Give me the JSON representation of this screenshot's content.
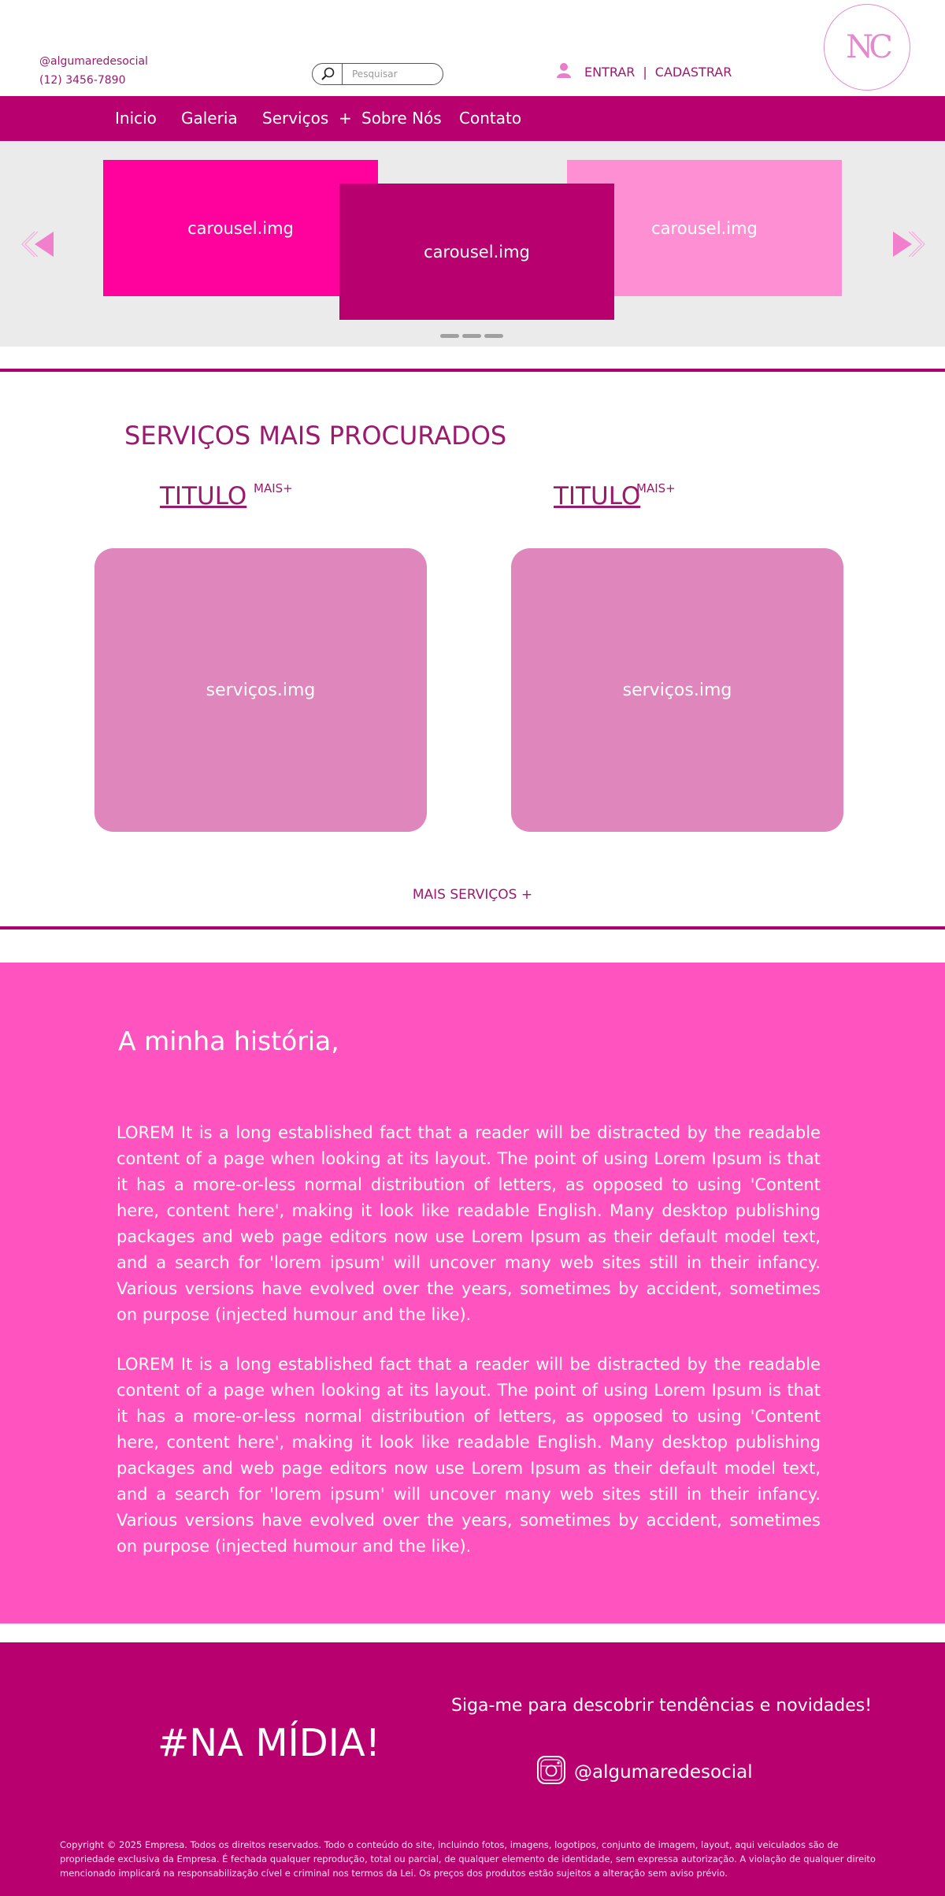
{
  "header": {
    "social_handle": "@algumaredesocial",
    "phone": "(12) 3456-7890",
    "search": {
      "placeholder": "Pesquisar"
    },
    "login_label": "ENTRAR",
    "separator": "|",
    "signup_label": "CADASTRAR",
    "logo_text": "NC"
  },
  "nav": {
    "items": [
      {
        "label": "Inicio"
      },
      {
        "label": "Galeria"
      },
      {
        "label": "Serviços  +"
      },
      {
        "label": "Sobre Nós"
      },
      {
        "label": "Contato"
      }
    ]
  },
  "carousel": {
    "slides": [
      {
        "label": "carousel.img"
      },
      {
        "label": "carousel.img"
      },
      {
        "label": "carousel.img"
      }
    ],
    "indicator_count": 3
  },
  "services": {
    "title": "SERVIÇOS MAIS PROCURADOS",
    "cards": [
      {
        "title": "TITULO",
        "badge": "MAIS+",
        "image_label": "serviços.img"
      },
      {
        "title": "TITULO",
        "badge": "MAIS+",
        "image_label": "serviços.img"
      }
    ],
    "more_label": "MAIS SERVIÇOS +"
  },
  "story": {
    "title": "A minha história,",
    "paragraphs": [
      "LOREM It is a long established fact that a reader will be distracted by the readable content of a page when looking at its layout. The point of using Lorem Ipsum is that it has a more-or-less normal distribution of letters, as opposed to using 'Content here, content here', making it look like readable English. Many desktop publishing packages and web page editors now use Lorem Ipsum as their default model text, and a search for 'lorem ipsum' will uncover many web sites still in their infancy. Various versions have evolved over the years, sometimes by accident, sometimes on purpose (injected humour and the like).",
      "LOREM It is a long established fact that a reader will be distracted by the readable content of a page when looking at its layout. The point of using Lorem Ipsum is that it has a more-or-less normal distribution of letters, as opposed to using 'Content here, content here', making it look like readable English. Many desktop publishing packages and web page editors now use Lorem Ipsum as their default model text, and a search for 'lorem ipsum' will uncover many web sites still in their infancy. Various versions have evolved over the years, sometimes by accident, sometimes on purpose (injected humour and the like)."
    ]
  },
  "footer": {
    "media_title": "#NA MÍDIA!",
    "follow_text": "Siga-me para descobrir tendências e novidades!",
    "social_handle": "@algumaredesocial",
    "copyright": "Copyright © 2025 Empresa. Todos os direitos reservados. Todo o conteúdo do site, incluindo fotos, imagens, logotipos, conjunto de imagem, layout, aqui veiculados são de propriedade exclusiva da Empresa. É fechada qualquer reprodução, total ou parcial, de qualquer elemento de identidade, sem expressa autorização. A violação de qualquer direito mencionado implicará na responsabilização cível e criminal nos termos da Lei. Os preços dos produtos estão sujeitos a alteração sem aviso prévio."
  },
  "colors": {
    "primary": "#b9006f",
    "accent_pink": "#ff53bf",
    "card_pink": "#df86bc",
    "slide_hot_pink": "#ff019c",
    "slide_light_pink": "#fe8fd3",
    "carousel_bg": "#ebebeb"
  },
  "icons": {
    "search": "search-icon",
    "user": "user-icon",
    "prev": "arrow-left-icon",
    "next": "arrow-right-icon",
    "social": "instagram-icon"
  }
}
